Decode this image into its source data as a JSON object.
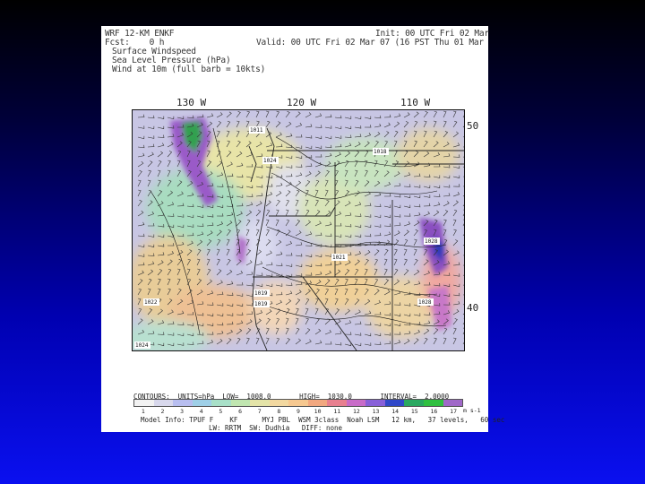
{
  "header": {
    "model": "WRF 12-KM ENKF",
    "fcst": "Fcst:    0 h",
    "fields": [
      "Surface Windspeed",
      "Sea Level Pressure (hPa)",
      "Wind at 10m (full barb = 10kts)"
    ],
    "init": "Init: 00 UTC Fri 02 Mar",
    "valid": "Valid: 00 UTC Fri 02 Mar 07 (16 PST Thu 01 Mar"
  },
  "axes": {
    "longitude_labels": [
      "130 W",
      "120 W",
      "110 W"
    ],
    "latitude_labels": [
      "50",
      "40"
    ]
  },
  "colorbar": {
    "colors": [
      "#f2f2f2",
      "#d8d8ec",
      "#b8bef0",
      "#9fd0e8",
      "#a8e0c8",
      "#c0e6b0",
      "#e4e4a8",
      "#f2d8a0",
      "#f6c890",
      "#f2a880",
      "#e88090",
      "#c86cc8",
      "#8860d8",
      "#3048c8",
      "#2aa860",
      "#30c040",
      "#a068c8"
    ],
    "labels": [
      "1",
      "2",
      "3",
      "4",
      "5",
      "6",
      "7",
      "8",
      "9",
      "10",
      "11",
      "12",
      "13",
      "14",
      "15",
      "16",
      "17"
    ],
    "unit": "m s-1"
  },
  "footer": {
    "contours": "CONTOURS:  UNITS=hPa  LOW=  1008.0       HIGH=  1030.0       INTERVAL=  2.0000",
    "physics": "Model Info: TPUF F    KF      MYJ PBL  WSM 3class  Noah LSM   12 km,   37 levels,   60 sec",
    "radiation": "LW: RRTM  SW: Dudhia   DIFF: none"
  },
  "map_labels": {
    "pressure_centers": [
      "1011",
      "1024",
      "1018",
      "1019",
      "1019",
      "1021",
      "1028",
      "1028",
      "1022",
      "1024",
      "1024",
      "1024",
      "1024"
    ]
  }
}
